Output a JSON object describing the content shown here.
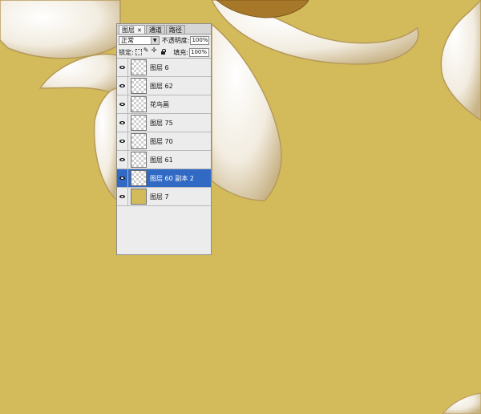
{
  "panel": {
    "tabs": [
      {
        "label": "图层",
        "close": "✕",
        "active": true
      },
      {
        "label": "通道",
        "active": false
      },
      {
        "label": "路径",
        "active": false
      }
    ],
    "blend_mode": "正常",
    "opacity_label": "不透明度:",
    "opacity_value": "100%",
    "lock_label": "锁定:",
    "fill_label": "填充:",
    "fill_value": "100%",
    "lock_icons": [
      "lock-transparent-icon",
      "lock-brush-icon",
      "lock-move-icon",
      "lock-all-icon"
    ],
    "layers": [
      {
        "name": "图层 6",
        "selected": false,
        "thumb": "checker"
      },
      {
        "name": "图层 62",
        "selected": false,
        "thumb": "checker"
      },
      {
        "name": "花鸟画",
        "selected": false,
        "thumb": "checker"
      },
      {
        "name": "图层 75",
        "selected": false,
        "thumb": "checker"
      },
      {
        "name": "图层 70",
        "selected": false,
        "thumb": "checker"
      },
      {
        "name": "图层 61",
        "selected": false,
        "thumb": "checker"
      },
      {
        "name": "图层 60 副本 2",
        "selected": true,
        "thumb": "checker"
      },
      {
        "name": "图层 7",
        "selected": false,
        "thumb": "solid"
      }
    ]
  },
  "colors": {
    "canvas_background": "#d3bb5c",
    "selection": "#316ac5",
    "petal": "#f6f1e4"
  }
}
